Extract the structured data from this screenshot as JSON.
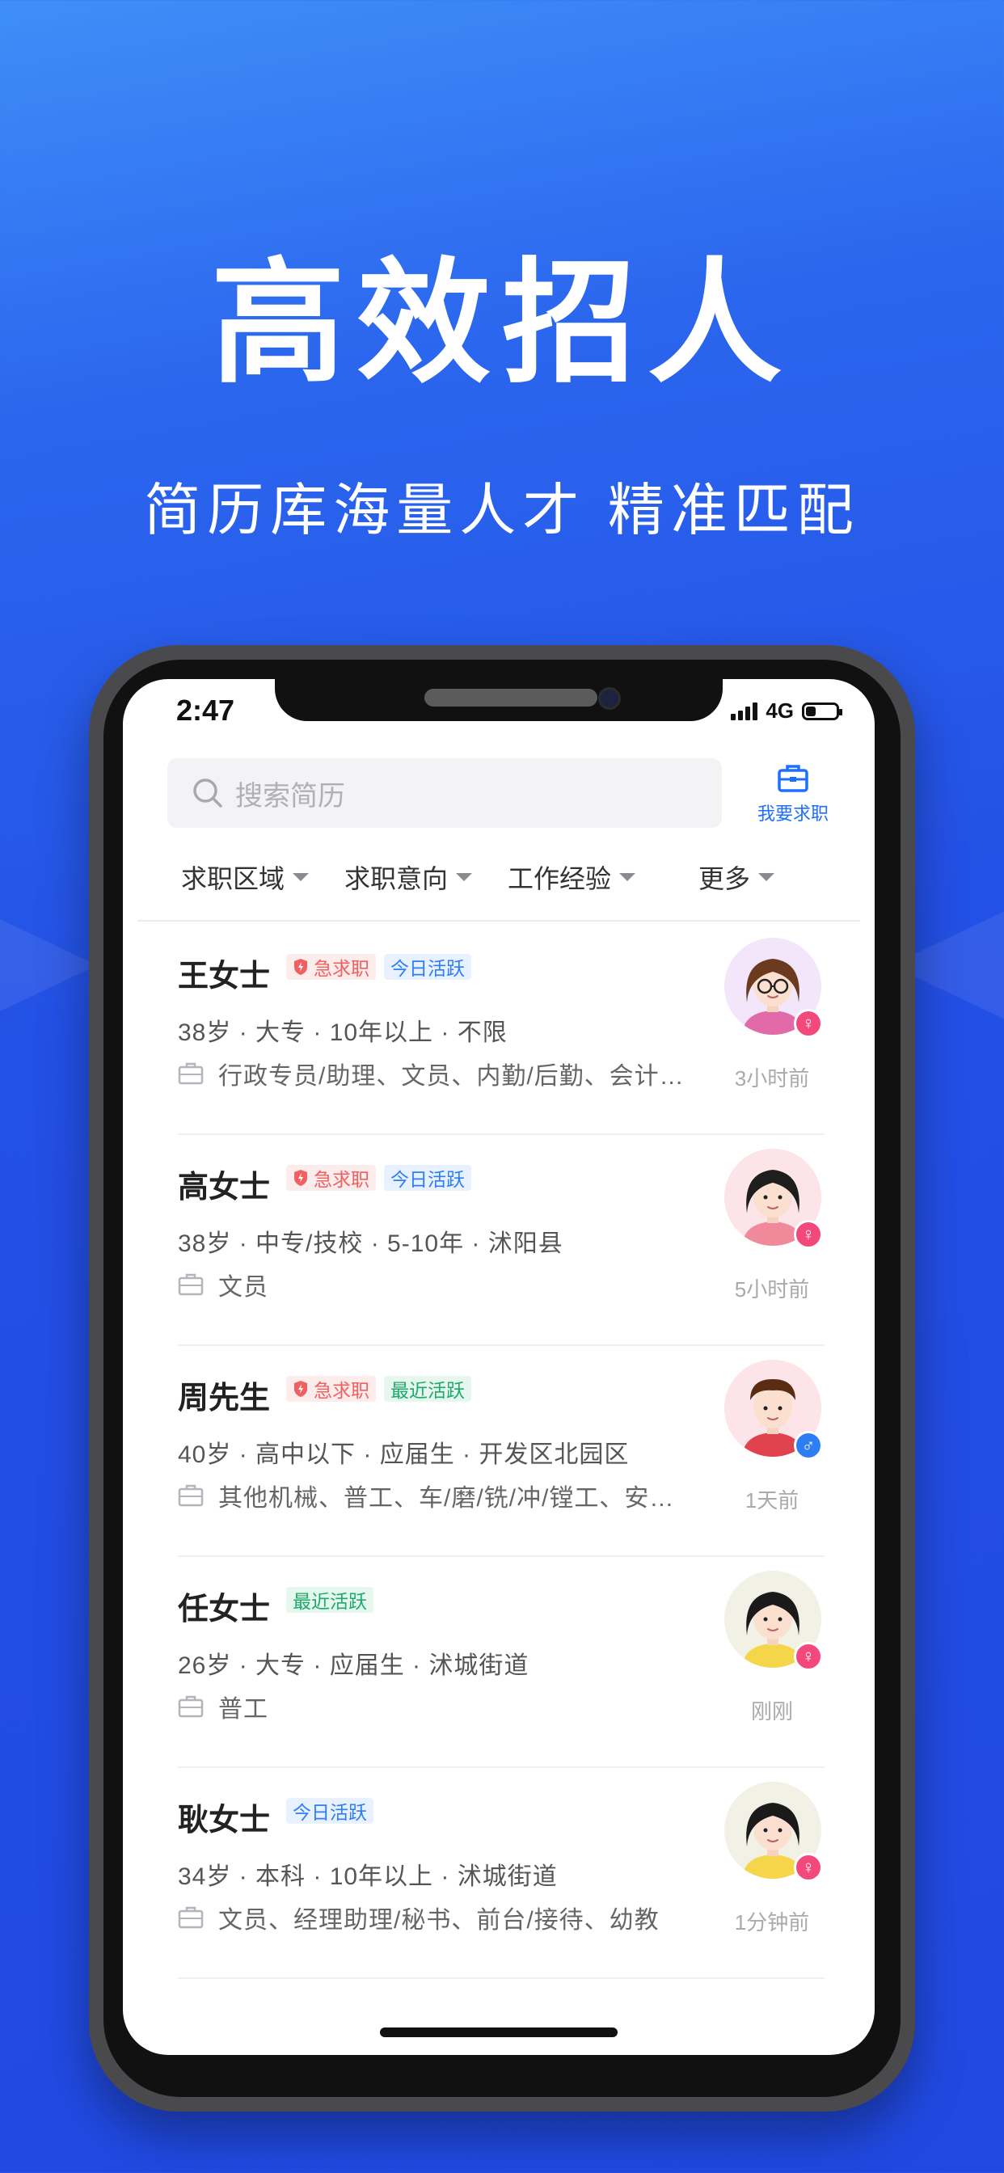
{
  "hero": {
    "title": "高效招人",
    "subtitle": "简历库海量人才  精准匹配"
  },
  "status_bar": {
    "time": "2:47",
    "network": "4G"
  },
  "search": {
    "placeholder": "搜索简历",
    "icon": "search-icon"
  },
  "job_button": {
    "label": "我要求职",
    "icon": "briefcase-icon"
  },
  "filters": [
    "求职区域",
    "求职意向",
    "工作经验",
    "更多"
  ],
  "candidates": [
    {
      "name": "王女士",
      "tags": [
        {
          "type": "urgent",
          "label": "急求职"
        },
        {
          "type": "today",
          "label": "今日活跃"
        }
      ],
      "meta": "38岁 · 大专 · 10年以上 · 不限",
      "jobs": "行政专员/助理、文员、内勤/后勤、会计…",
      "time": "3小时前",
      "gender": "female",
      "gender_symbol": "♀"
    },
    {
      "name": "高女士",
      "tags": [
        {
          "type": "urgent",
          "label": "急求职"
        },
        {
          "type": "today",
          "label": "今日活跃"
        }
      ],
      "meta": "38岁 · 中专/技校 · 5-10年 · 沭阳县",
      "jobs": "文员",
      "time": "5小时前",
      "gender": "female",
      "gender_symbol": "♀"
    },
    {
      "name": "周先生",
      "tags": [
        {
          "type": "urgent",
          "label": "急求职"
        },
        {
          "type": "recent",
          "label": "最近活跃"
        }
      ],
      "meta": "40岁 · 高中以下 · 应届生 · 开发区北园区",
      "jobs": "其他机械、普工、车/磨/铣/冲/镗工、安…",
      "time": "1天前",
      "gender": "male",
      "gender_symbol": "♂"
    },
    {
      "name": "任女士",
      "tags": [
        {
          "type": "recent",
          "label": "最近活跃"
        }
      ],
      "meta": "26岁 · 大专 · 应届生 · 沭城街道",
      "jobs": "普工",
      "time": "刚刚",
      "gender": "female",
      "gender_symbol": "♀"
    },
    {
      "name": "耿女士",
      "tags": [
        {
          "type": "today",
          "label": "今日活跃"
        }
      ],
      "meta": "34岁 · 本科 · 10年以上 · 沭城街道",
      "jobs": "文员、经理助理/秘书、前台/接待、幼教",
      "time": "1分钟前",
      "gender": "female",
      "gender_symbol": "♀"
    }
  ],
  "colors": {
    "brand": "#2049e2",
    "accent_blue": "#1f6fff",
    "urgent": "#f16060",
    "today": "#2d7df5",
    "recent": "#1faa6a"
  }
}
